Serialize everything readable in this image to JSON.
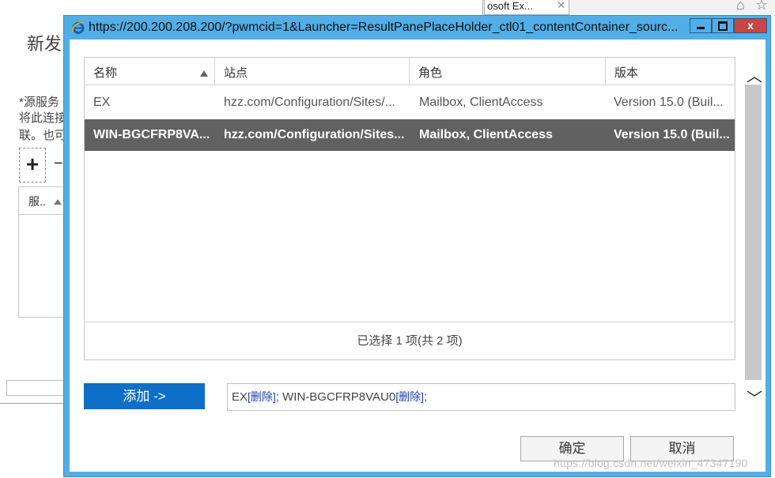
{
  "background": {
    "title": "新发",
    "lines": [
      "*源服务",
      "将此连接",
      "联。也可"
    ],
    "add_symbol": "+",
    "remove_symbol": "−",
    "table_header": "服..",
    "tab_label": "osoft Ex...",
    "tab_close": "✕",
    "home_icon": "⌂",
    "star_icon": "☆"
  },
  "dialog": {
    "title": "https://200.200.208.200/?pwmcid=1&Launcher=ResultPanePlaceHolder_ctl01_contentContainer_sourc...",
    "close_label": "x"
  },
  "grid": {
    "columns": [
      "名称",
      "站点",
      "角色",
      "版本"
    ],
    "rows": [
      {
        "name": "EX",
        "site": "hzz.com/Configuration/Sites/...",
        "role": "Mailbox, ClientAccess",
        "version": "Version 15.0 (Buil..."
      },
      {
        "name": "WIN-BGCFRP8VA...",
        "site": "hzz.com/Configuration/Sites...",
        "role": "Mailbox, ClientAccess",
        "version": "Version 15.0 (Buil..."
      }
    ],
    "status": "已选择 1 项(共 2 项)"
  },
  "scrollbar": {
    "up": "︿",
    "down": "﹀"
  },
  "add_button": "添加 ->",
  "selection": {
    "item1": "EX",
    "item2": "WIN-BGCFRP8VAU0",
    "delete_label": "[删除]",
    "separator": "; ",
    "trailing": ";"
  },
  "footer": {
    "ok": "确定",
    "cancel": "取消"
  },
  "watermark": "https://blog.csdn.net/weixin_47347190",
  "colors": {
    "title_bar": "#52aee6",
    "selected_row": "#616161",
    "primary_button": "#0e6fc9",
    "close_button": "#c74545"
  }
}
